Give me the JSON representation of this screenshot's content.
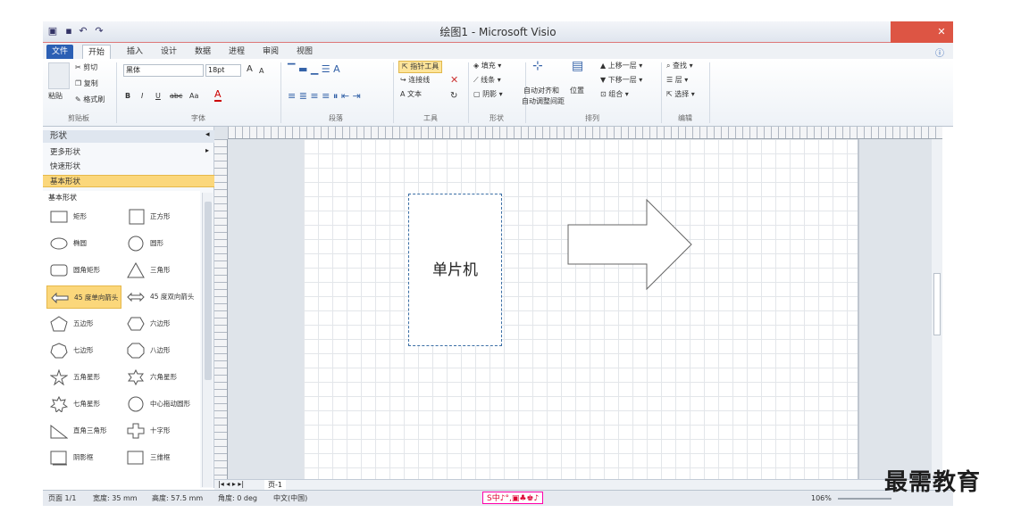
{
  "window": {
    "title": "绘图1 - Microsoft Visio"
  },
  "tabs": [
    "文件",
    "开始",
    "插入",
    "设计",
    "数据",
    "进程",
    "审阅",
    "视图"
  ],
  "ribbon": {
    "clipboard": {
      "paste": "粘贴",
      "cut": "剪切",
      "copy": "复制",
      "format_painter": "格式刷",
      "label": "剪贴板"
    },
    "font": {
      "name": "黑体",
      "size": "18pt",
      "bold": "B",
      "italic": "I",
      "underline": "U",
      "strike": "abc",
      "aa": "Aa",
      "grow": "A",
      "shrink": "A",
      "color": "A",
      "label": "字体"
    },
    "paragraph": {
      "label": "段落"
    },
    "tools": {
      "pointer": "指针工具",
      "connector": "连接线",
      "text": "文本",
      "label": "工具"
    },
    "shape": {
      "fill": "填充",
      "line": "线条",
      "shadow": "阴影",
      "label": "形状"
    },
    "arrange": {
      "auto_align": "自动对齐和",
      "auto_space": "自动调整间距",
      "position": "位置",
      "bring_forward": "上移一层",
      "send_backward": "下移一层",
      "group": "组合",
      "label": "排列"
    },
    "editing": {
      "find": "查找",
      "layers": "层",
      "select": "选择",
      "label": "编辑"
    }
  },
  "shapes_pane": {
    "title": "形状",
    "more": "更多形状",
    "quick": "快速形状",
    "basic": "基本形状",
    "stencil_title": "基本形状",
    "items": [
      [
        "矩形",
        "正方形"
      ],
      [
        "椭圆",
        "圆形"
      ],
      [
        "圆角矩形",
        "三角形"
      ],
      [
        "45 度单向箭头",
        "45 度双向箭头"
      ],
      [
        "五边形",
        "六边形"
      ],
      [
        "七边形",
        "八边形"
      ],
      [
        "五角星形",
        "六角星形"
      ],
      [
        "七角星形",
        "中心拖动圆形"
      ],
      [
        "直角三角形",
        "十字形"
      ],
      [
        "阴影框",
        "三维框"
      ]
    ]
  },
  "canvas": {
    "shape_text": "单片机",
    "page_tab": "页-1"
  },
  "status": {
    "page": "页面 1/1",
    "width": "宽度: 35 mm",
    "height": "高度: 57.5 mm",
    "angle": "角度: 0 deg",
    "lang": "中文(中国)",
    "zoom": "106%"
  },
  "ime": "S中♪°,▣♣♚♪",
  "watermark": "最需教育"
}
